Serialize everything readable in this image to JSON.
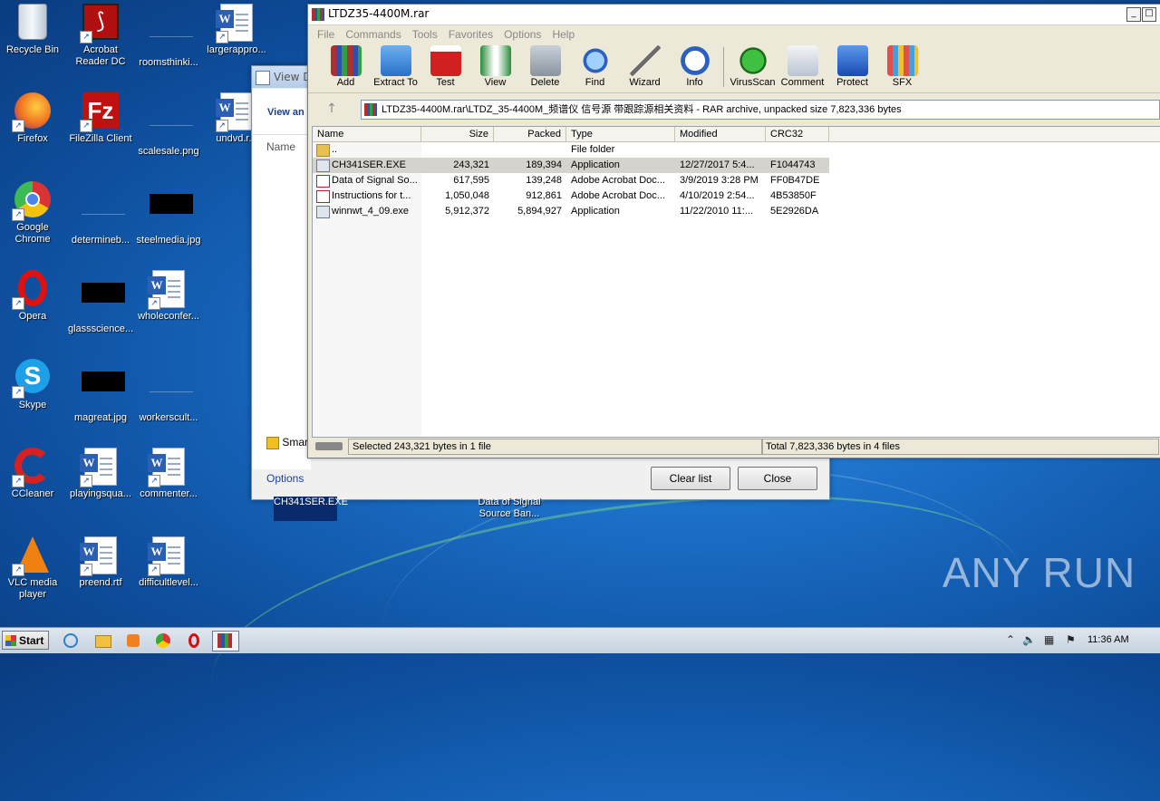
{
  "desktop": {
    "icons": [
      {
        "label": "Recycle Bin"
      },
      {
        "label": "Acrobat Reader DC"
      },
      {
        "label": "roomsthinki..."
      },
      {
        "label": "largerappro..."
      },
      {
        "label": "Firefox"
      },
      {
        "label": "FileZilla Client"
      },
      {
        "label": "scalesale.png"
      },
      {
        "label": "undvd.r..."
      },
      {
        "label": "Google Chrome"
      },
      {
        "label": "determineb..."
      },
      {
        "label": "steelmedia.jpg"
      },
      {
        "label": "Opera"
      },
      {
        "label": "glassscience..."
      },
      {
        "label": "wholeconfer..."
      },
      {
        "label": "Skype"
      },
      {
        "label": "magreat.jpg"
      },
      {
        "label": "workerscult..."
      },
      {
        "label": "CCleaner"
      },
      {
        "label": "playingsqua..."
      },
      {
        "label": "commenter..."
      },
      {
        "label": "VLC media player"
      },
      {
        "label": "preend.rtf"
      },
      {
        "label": "difficultlevel..."
      }
    ],
    "selected_file_label": "CH341SER.EXE",
    "extracted_label": "Data of Signal Source Ban..."
  },
  "bg_dialog": {
    "title": "View D",
    "heading": "View an",
    "name_col": "Name",
    "smart_label": "Smar",
    "options_link": "Options",
    "clear_list": "Clear list",
    "close": "Close"
  },
  "winrar": {
    "title": "LTDZ35-4400M.rar",
    "menu": [
      "File",
      "Commands",
      "Tools",
      "Favorites",
      "Options",
      "Help"
    ],
    "toolbar": [
      {
        "label": "Add",
        "icon": "add-archive-icon"
      },
      {
        "label": "Extract To",
        "icon": "extract-folder-icon"
      },
      {
        "label": "Test",
        "icon": "test-clipboard-icon"
      },
      {
        "label": "View",
        "icon": "view-book-icon"
      },
      {
        "label": "Delete",
        "icon": "trash-icon"
      },
      {
        "label": "Find",
        "icon": "magnifier-icon"
      },
      {
        "label": "Wizard",
        "icon": "wand-icon"
      },
      {
        "label": "Info",
        "icon": "info-icon"
      },
      {
        "label": "VirusScan",
        "icon": "bug-icon"
      },
      {
        "label": "Comment",
        "icon": "comment-icon"
      },
      {
        "label": "Protect",
        "icon": "shield-icon"
      },
      {
        "label": "SFX",
        "icon": "sfx-box-icon"
      }
    ],
    "path": "LTDZ35-4400M.rar\\LTDZ_35-4400M_频谱仪 信号源 带跟踪源相关资料 - RAR archive, unpacked size 7,823,336 bytes",
    "columns": [
      "Name",
      "Size",
      "Packed",
      "Type",
      "Modified",
      "CRC32"
    ],
    "files": [
      {
        "name": "..",
        "size": "",
        "packed": "",
        "type": "File folder",
        "modified": "",
        "crc": "",
        "icon": "folder-icon"
      },
      {
        "name": "CH341SER.EXE",
        "size": "243,321",
        "packed": "189,394",
        "type": "Application",
        "modified": "12/27/2017 5:4...",
        "crc": "F1044743",
        "icon": "exe-icon",
        "selected": true
      },
      {
        "name": "Data of Signal So...",
        "size": "617,595",
        "packed": "139,248",
        "type": "Adobe Acrobat Doc...",
        "modified": "3/9/2019 3:28 PM",
        "crc": "FF0B47DE",
        "icon": "pdf-icon"
      },
      {
        "name": "Instructions for t...",
        "size": "1,050,048",
        "packed": "912,861",
        "type": "Adobe Acrobat Doc...",
        "modified": "4/10/2019 2:54...",
        "crc": "4B53850F",
        "icon": "pdf-icon"
      },
      {
        "name": "winnwt_4_09.exe",
        "size": "5,912,372",
        "packed": "5,894,927",
        "type": "Application",
        "modified": "11/22/2010 11:...",
        "crc": "5E2926DA",
        "icon": "exe-icon"
      }
    ],
    "status_left": "Selected 243,321 bytes in 1 file",
    "status_right": "Total 7,823,336 bytes in 4 files"
  },
  "taskbar": {
    "start": "Start",
    "clock": "11:36 AM"
  },
  "watermark": "ANY RUN"
}
